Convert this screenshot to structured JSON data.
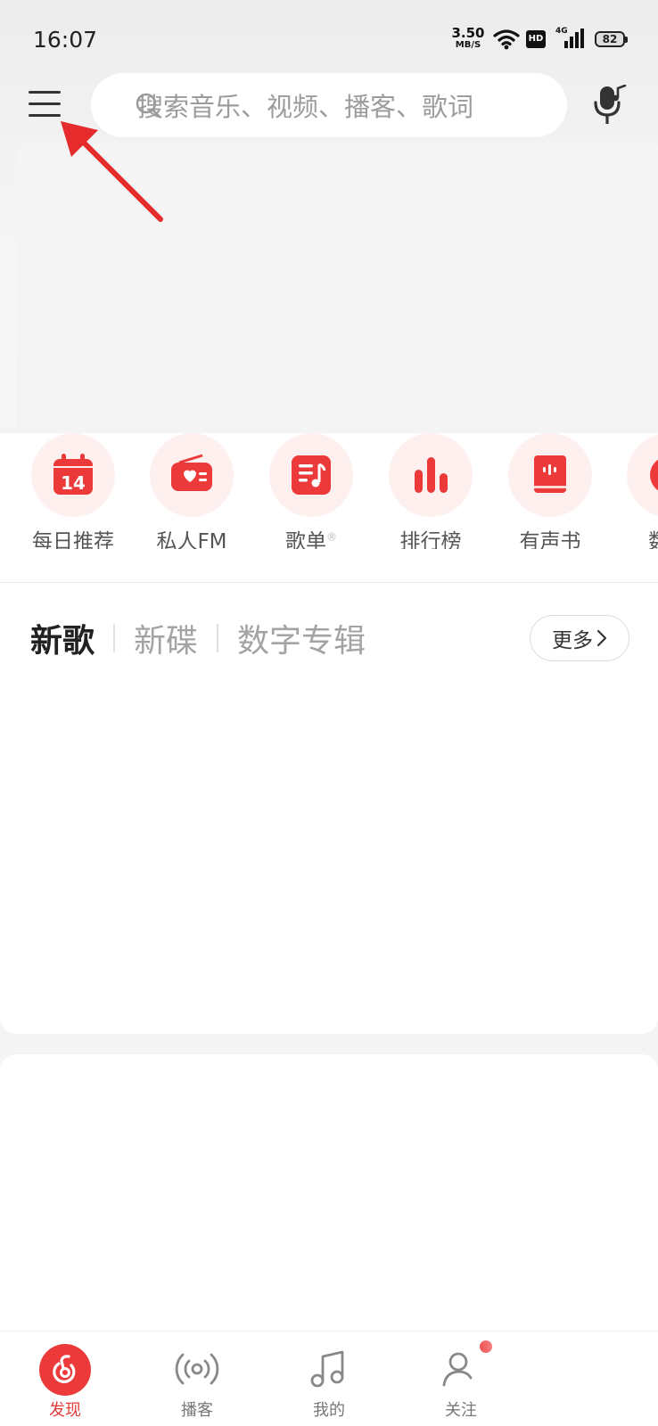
{
  "status_bar": {
    "time": "16:07",
    "net_speed_value": "3.50",
    "net_speed_unit": "MB/S",
    "hd_badge": "HD",
    "network_type": "4G",
    "battery": "82"
  },
  "header": {
    "menu_icon": "hamburger-menu-icon",
    "search_placeholder": "搜索音乐、视频、播客、歌词",
    "search_icon": "search-icon",
    "voice_icon": "microphone-music-icon"
  },
  "annotation": {
    "arrow_color": "#e52b2b",
    "points_to": "menu-button"
  },
  "shortcuts": [
    {
      "label": "每日推荐",
      "icon": "calendar-icon",
      "badge": "14"
    },
    {
      "label": "私人FM",
      "icon": "radio-icon"
    },
    {
      "label": "歌单",
      "icon": "playlist-icon",
      "superscript": "®"
    },
    {
      "label": "排行榜",
      "icon": "bar-chart-icon"
    },
    {
      "label": "有声书",
      "icon": "audiobook-icon"
    },
    {
      "label": "数字",
      "icon": "digital-album-icon"
    }
  ],
  "new_music": {
    "tabs": [
      "新歌",
      "新碟",
      "数字专辑"
    ],
    "active_tab": "新歌",
    "more_label": "更多"
  },
  "bottom_nav": [
    {
      "label": "发现",
      "icon": "discover-icon",
      "active": true
    },
    {
      "label": "播客",
      "icon": "podcast-icon",
      "active": false
    },
    {
      "label": "我的",
      "icon": "music-note-icon",
      "active": false
    },
    {
      "label": "关注",
      "icon": "follow-icon",
      "active": false,
      "has_notification_dot": true
    }
  ],
  "colors": {
    "accent": "#ec3a3a",
    "shortcut_bg": "#fff0f0",
    "page_bg": "#f4f4f5"
  }
}
